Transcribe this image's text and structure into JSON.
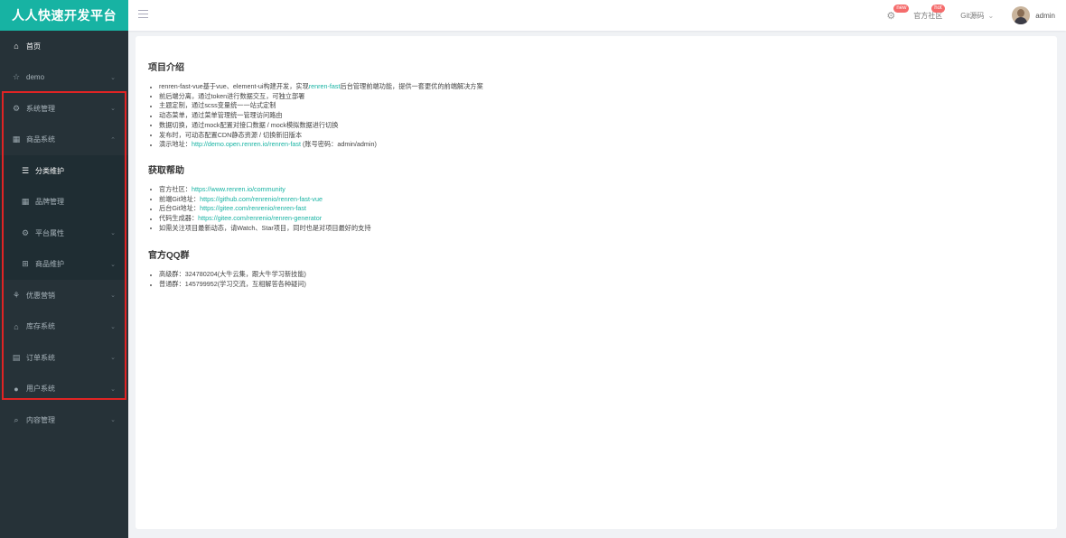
{
  "app": {
    "brand": "人人快速开发平台"
  },
  "navbar": {
    "new_badge": "new",
    "community_label": "官方社区",
    "hot_badge": "hot",
    "git_label": "Git源码",
    "username": "admin"
  },
  "sidebar": {
    "items": [
      {
        "icon": "home-icon",
        "glyph": "⌂",
        "label": "首页",
        "arrow": "",
        "active": true,
        "sub": false
      },
      {
        "icon": "star-icon",
        "glyph": "☆",
        "label": "demo",
        "arrow": "⌄",
        "active": false,
        "sub": false
      },
      {
        "icon": "settings-icon",
        "glyph": "⚙",
        "label": "系统管理",
        "arrow": "⌄",
        "active": false,
        "sub": false
      },
      {
        "icon": "grid-icon",
        "glyph": "▦",
        "label": "商品系统",
        "arrow": "⌃",
        "active": false,
        "sub": false
      },
      {
        "icon": "list-icon",
        "glyph": "☰",
        "label": "分类维护",
        "arrow": "",
        "active": true,
        "sub": true
      },
      {
        "icon": "grid-icon",
        "glyph": "▦",
        "label": "品牌管理",
        "arrow": "",
        "active": false,
        "sub": true
      },
      {
        "icon": "settings-icon",
        "glyph": "⚙",
        "label": "平台属性",
        "arrow": "⌄",
        "active": false,
        "sub": true
      },
      {
        "icon": "grid-icon",
        "glyph": "⊞",
        "label": "商品维护",
        "arrow": "⌄",
        "active": false,
        "sub": true
      },
      {
        "icon": "coupon-icon",
        "glyph": "⚘",
        "label": "优惠营销",
        "arrow": "⌄",
        "active": false,
        "sub": false
      },
      {
        "icon": "warehouse-icon",
        "glyph": "⌂",
        "label": "库存系统",
        "arrow": "⌄",
        "active": false,
        "sub": false
      },
      {
        "icon": "order-icon",
        "glyph": "▤",
        "label": "订单系统",
        "arrow": "⌄",
        "active": false,
        "sub": false
      },
      {
        "icon": "user-icon",
        "glyph": "●",
        "label": "用户系统",
        "arrow": "⌄",
        "active": false,
        "sub": false
      },
      {
        "icon": "search-icon",
        "glyph": "⌕",
        "label": "内容管理",
        "arrow": "⌄",
        "active": false,
        "sub": false
      }
    ]
  },
  "main": {
    "section1": {
      "title": "项目介绍",
      "items": [
        {
          "pre": "renren-fast-vue基于vue、element-ui构建开发，实现",
          "link": "renren-fast",
          "post": "后台管理前端功能，提供一套更优的前端解决方案"
        },
        {
          "pre": "前后端分离，通过token进行数据交互，可独立部署",
          "link": "",
          "post": ""
        },
        {
          "pre": "主题定制，通过scss变量统一一站式定制",
          "link": "",
          "post": ""
        },
        {
          "pre": "动态菜单，通过菜单管理统一管理访问路由",
          "link": "",
          "post": ""
        },
        {
          "pre": "数据切换，通过mock配置对接口数据 / mock模拟数据进行切换",
          "link": "",
          "post": ""
        },
        {
          "pre": "发布时，可动态配置CDN静态资源 / 切换新旧版本",
          "link": "",
          "post": ""
        },
        {
          "pre": "演示地址：",
          "link": "http://demo.open.renren.io/renren-fast",
          "post": " (账号密码：admin/admin)"
        }
      ]
    },
    "section2": {
      "title": "获取帮助",
      "items": [
        {
          "pre": "官方社区：",
          "link": "https://www.renren.io/community",
          "post": ""
        },
        {
          "pre": "前端Git地址：",
          "link": "https://github.com/renrenio/renren-fast-vue",
          "post": ""
        },
        {
          "pre": "后台Git地址：",
          "link": "https://gitee.com/renrenio/renren-fast",
          "post": ""
        },
        {
          "pre": "代码生成器：",
          "link": "https://gitee.com/renrenio/renren-generator",
          "post": ""
        },
        {
          "pre": "如需关注项目最新动态，请Watch、Star项目，同时也是对项目最好的支持",
          "link": "",
          "post": ""
        }
      ]
    },
    "section3": {
      "title": "官方QQ群",
      "items": [
        {
          "pre": "高级群：324780204(大牛云集，跟大牛学习新技能)",
          "link": "",
          "post": ""
        },
        {
          "pre": "普通群：145799952(学习交流，互相解答各种疑问)",
          "link": "",
          "post": ""
        }
      ]
    }
  }
}
